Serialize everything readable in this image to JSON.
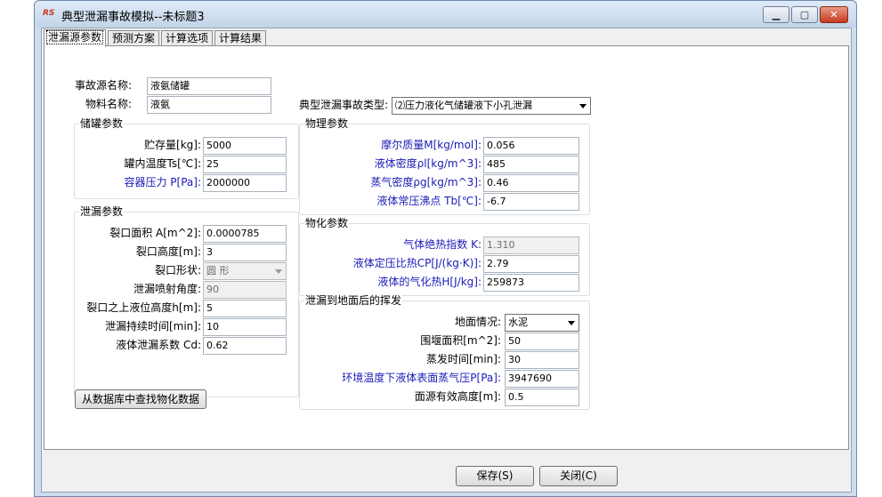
{
  "window": {
    "title": "典型泄漏事故模拟--未标题3",
    "icon": "app-logo-icon"
  },
  "tabs": [
    {
      "label": "泄漏源参数",
      "active": true
    },
    {
      "label": "预测方案",
      "active": false
    },
    {
      "label": "计算选项",
      "active": false
    },
    {
      "label": "计算结果",
      "active": false
    }
  ],
  "source": {
    "name_label": "事故源名称:",
    "name_value": "液氨储罐",
    "material_label": "物料名称:",
    "material_value": "液氨",
    "accident_type_label": "典型泄漏事故类型:",
    "accident_type_value": "⑵压力液化气储罐液下小孔泄漏"
  },
  "storage": {
    "title": "储罐参数",
    "capacity_label": "贮存量[kg]:",
    "capacity_value": "5000",
    "temp_label": "罐内温度Ts[℃]:",
    "temp_value": "25",
    "pressure_label": "容器压力 P[Pa]:",
    "pressure_value": "2000000"
  },
  "leak": {
    "title": "泄漏参数",
    "area_label": "裂口面积 A[m^2]:",
    "area_value": "0.0000785",
    "height_label": "裂口高度[m]:",
    "height_value": "3",
    "shape_label": "裂口形状:",
    "shape_value": "圆  形",
    "angle_label": "泄漏喷射角度:",
    "angle_value": "90",
    "liquid_height_label": "裂口之上液位高度h[m]:",
    "liquid_height_value": "5",
    "duration_label": "泄漏持续时间[min]:",
    "duration_value": "10",
    "coef_label": "液体泄漏系数  Cd:",
    "coef_value": "0.62"
  },
  "physical": {
    "title": "物理参数",
    "molar_label": "摩尔质量M[kg/mol]:",
    "molar_value": "0.056",
    "liquid_density_label": "液体密度ρl[kg/m^3]:",
    "liquid_density_value": "485",
    "vapor_density_label": "蒸气密度ρg[kg/m^3]:",
    "vapor_density_value": "0.46",
    "boiling_label": "液体常压沸点 Tb[℃]:",
    "boiling_value": "-6.7"
  },
  "chemical": {
    "title": "物化参数",
    "adiabatic_label": "气体绝热指数  K:",
    "adiabatic_value": "1.310",
    "cp_label": "液体定压比热CP[J/(kg·K)]:",
    "cp_value": "2.79",
    "heat_label": "液体的气化热H[J/kg]:",
    "heat_value": "259873"
  },
  "evaporation": {
    "title": "泄漏到地面后的挥发",
    "ground_label": "地面情况:",
    "ground_value": "水泥",
    "dike_area_label": "围堰面积[m^2]:",
    "dike_area_value": "50",
    "evap_time_label": "蒸发时间[min]:",
    "evap_time_value": "30",
    "vapor_pressure_label": "环境温度下液体表面蒸气压P[Pa]:",
    "vapor_pressure_value": "3947690",
    "effective_height_label": "面源有效高度[m]:",
    "effective_height_value": "0.5"
  },
  "buttons": {
    "lookup_label": "从数据库中查找物化数据",
    "save_label": "保存(S)",
    "close_label": "关闭(C)"
  },
  "colors": {
    "accent_label": "#1a1ab8",
    "titlebar": "#c3d4e9",
    "close": "#c63a1f"
  }
}
